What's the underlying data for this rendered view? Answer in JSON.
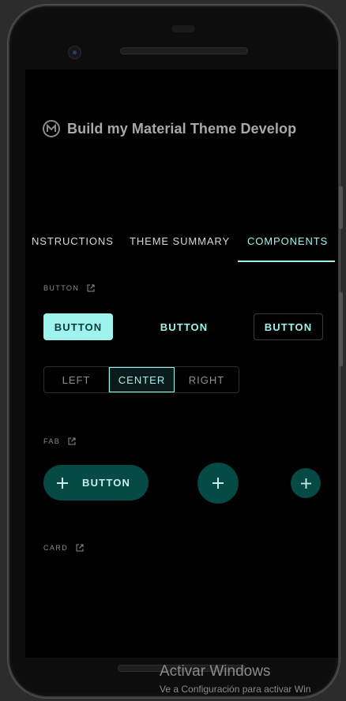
{
  "app": {
    "title": "Build my Material Theme Develop",
    "logo_icon": "material-logo-icon"
  },
  "tabs": [
    {
      "label": "NSTRUCTIONS",
      "active": false
    },
    {
      "label": "THEME SUMMARY",
      "active": false
    },
    {
      "label": "COMPONENTS",
      "active": true
    }
  ],
  "sections": {
    "button": {
      "label": "BUTTON",
      "icon": "open-in-new-icon"
    },
    "fab": {
      "label": "FAB",
      "icon": "open-in-new-icon"
    },
    "card": {
      "label": "CARD",
      "icon": "open-in-new-icon"
    }
  },
  "buttons": {
    "filled": "BUTTON",
    "text": "BUTTON",
    "outlined": "BUTTON"
  },
  "toggle_group": {
    "options": [
      "LEFT",
      "CENTER",
      "RIGHT"
    ],
    "selected": "CENTER"
  },
  "fab": {
    "extended_label": "BUTTON",
    "icon": "plus-icon"
  },
  "colors": {
    "primary": "#9ff3ee",
    "secondary_container": "#054a44",
    "background": "#000000"
  },
  "watermark": {
    "title": "Activar Windows",
    "subtitle": "Ve a Configuración para activar Win"
  }
}
